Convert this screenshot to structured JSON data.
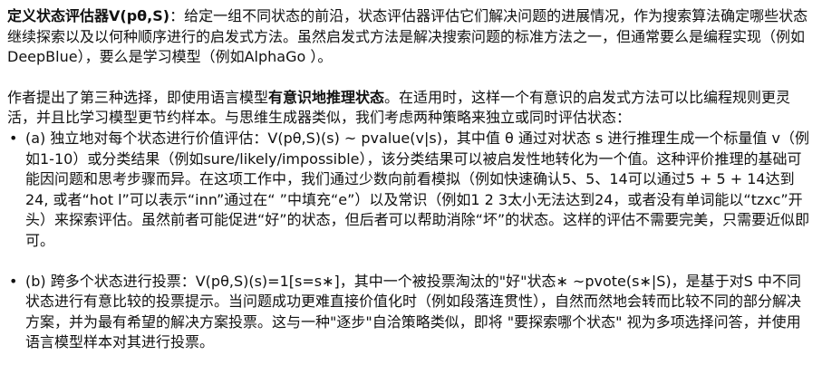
{
  "intro": {
    "term": "定义状态评估器V(pθ,S)",
    "text": "：给定一组不同状态的前沿，状态评估器评估它们解决问题的进展情况，作为搜索算法确定哪些状态继续探索以及以何种顺序进行的启发式方法。虽然启发式方法是解决搜索问题的标准方法之一，但通常要么是编程实现（例如DeepBlue），要么是学习模型（例如AlphaGo ）。"
  },
  "proposal": {
    "prefix": "作者提出了第三种选择，即使用语言模型",
    "emphasis": "有意识地推理状态",
    "suffix": "。在适用时，这样一个有意识的启发式方法可以比编程规则更灵活，并且比学习模型更节约样本。与思维生成器类似，我们考虑两种策略来独立或同时评估状态："
  },
  "strategies": [
    {
      "bullet": "•",
      "text": "(a) 独立地对每个状态进行价值评估：V(pθ,S)(s) ~ pvalue(v|s)，其中值 θ 通过对状态 s 进行推理生成一个标量值 v（例如1-10）或分类结果（例如sure/likely/impossible），该分类结果可以被启发性地转化为一个值。这种评价推理的基础可能因问题和思考步骤而异。在这项工作中，我们通过少数向前看模拟（例如快速确认5、5、14可以通过5 + 5 + 14达到24, 或者“hot l”可以表示“inn”通过在“ ”中填充“e”）以及常识（例如1 2 3太小无法达到24，或者没有单词能以“tzxc”开头）来探索评估。虽然前者可能促进“好”的状态，但后者可以帮助消除“坏”的状态。这样的评估不需要完美，只需要近似即可。"
    },
    {
      "bullet": "•",
      "text": "(b) 跨多个状态进行投票：V(pθ,S)(s)=1[s=s∗]，其中一个被投票淘汰的\"好\"状态∗ ~pvote(s∗|S)，是基于对S 中不同状态进行有意比较的投票提示。当问题成功更难直接价值化时（例如段落连贯性），自然而然地会转而比较不同的部分解决方案，并为最有希望的解决方案投票。这与一种\"逐步\"自洽策略类似，即将 \"要探索哪个状态\" 视为多项选择问答，并使用语言模型样本对其进行投票。"
    }
  ]
}
